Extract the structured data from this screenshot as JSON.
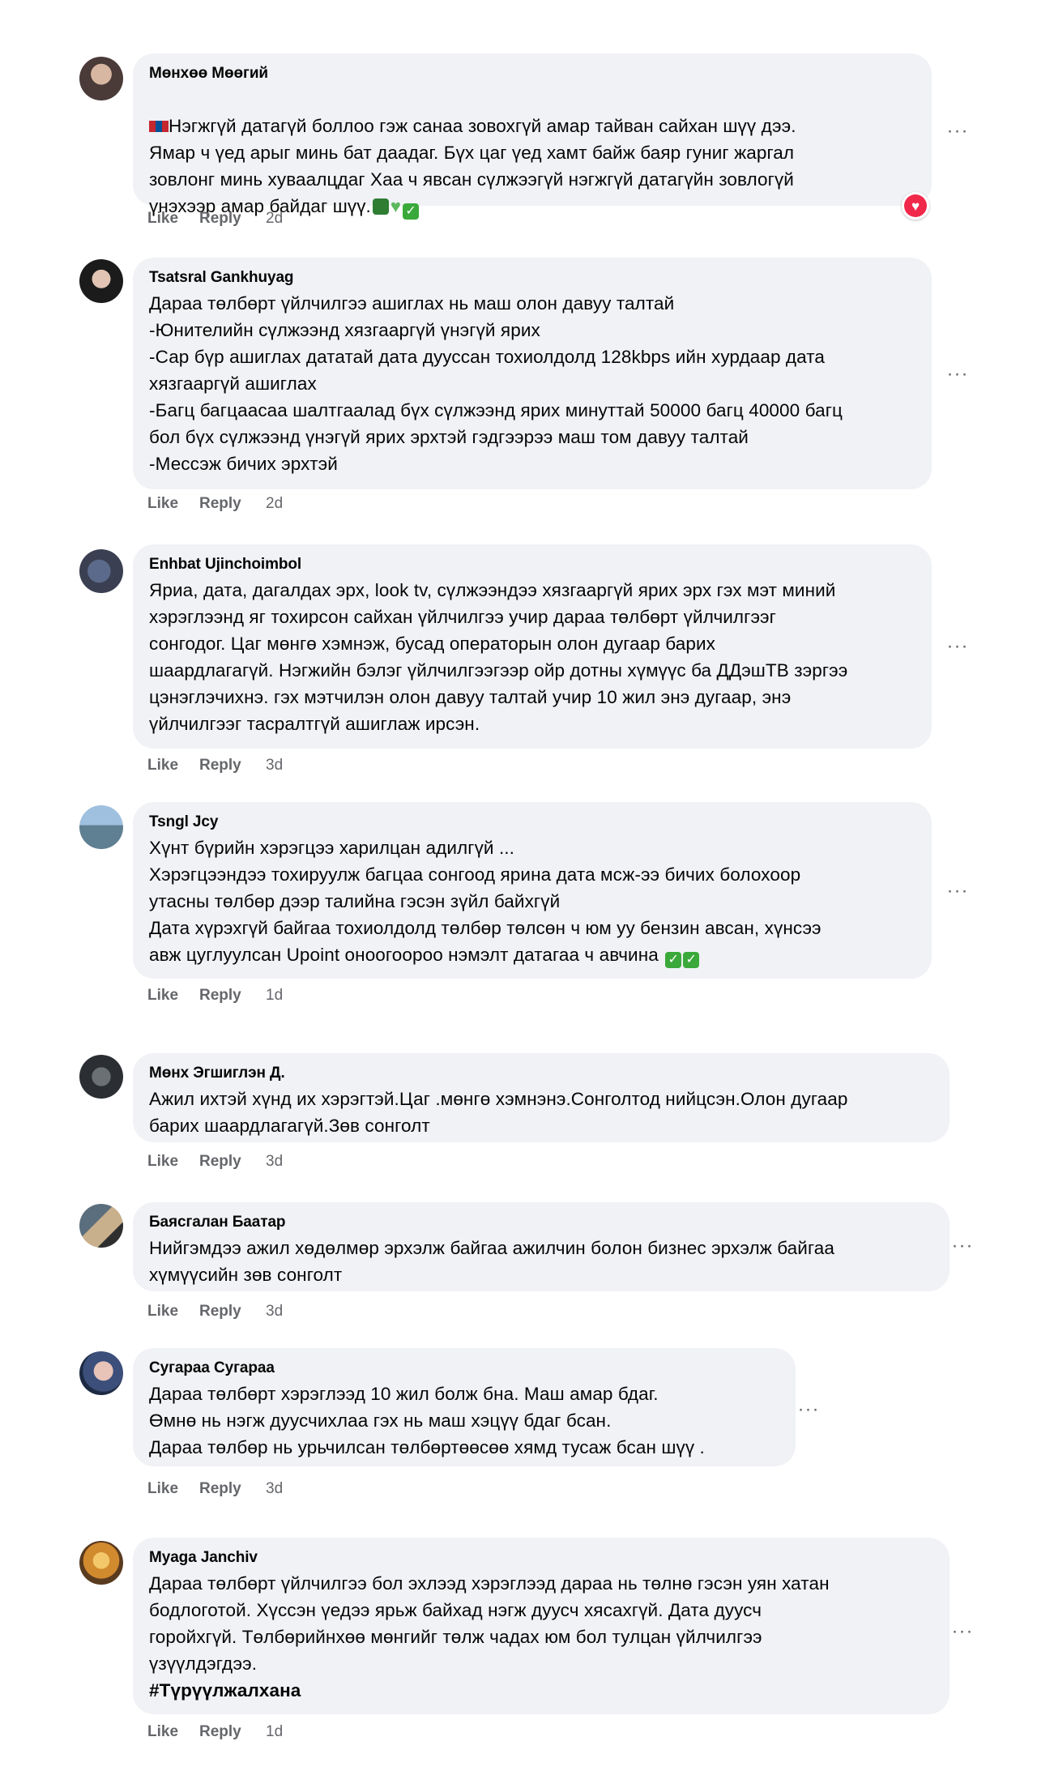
{
  "actions": {
    "like": "Like",
    "reply": "Reply"
  },
  "comments": [
    {
      "author": "Мөнхөө Мөөгий",
      "text": "Нэгжгүй датагүй боллоо гэж санаа зовохгүй амар тайван сайхан шүү дээ.\nЯмар ч үед арыг минь бат даадаг. Бүх цаг үед хамт байж баяр гуниг жаргал\nзовлонг минь хуваалцдаг Хаа ч явсан сүлжээгүй нэгжгүй датагүйн зовлогүй\nүнэхээр амар байдаг шүү.",
      "time": "2d",
      "reaction": "heart"
    },
    {
      "author": "Tsatsral Gankhuyag",
      "text": "Дараа төлбөрт үйлчилгээ ашиглах нь маш олон давуу талтай\n-Юнителийн сүлжээнд хязгааргүй үнэгүй ярих\n-Сар бүр ашиглах дататай дата дууссан тохиолдолд 128kbps ийн хурдаар дата\nхязгааргүй ашиглах\n-Багц багцаасаа шалтгаалад бүх сүлжээнд ярих минуттай 50000 багц 40000 багц\nбол бүх сүлжээнд үнэгүй ярих эрхтэй гэдгээрээ маш том давуу талтай\n-Мессэж бичих эрхтэй",
      "time": "2d"
    },
    {
      "author": "Enhbat Ujinchoimbol",
      "text": "Яриа, дата, дагалдах эрх, look tv, сүлжээндээ хязгааргүй ярих эрх гэх мэт миний\nхэрэглээнд яг тохирсон сайхан үйлчилгээ учир дараа төлбөрт үйлчилгээг\nсонгодог. Цаг мөнгө хэмнэж, бусад операторын олон дугаар барих\nшаардлагагүй. Нэгжийн бэлэг үйлчилгээгээр ойр дотны хүмүүс ба ДДэшТВ зэргээ\nцэнэглэчихнэ. гэх мэтчилэн олон давуу талтай учир 10 жил энэ дугаар, энэ\nүйлчилгээг тасралтгүй ашиглаж ирсэн.",
      "time": "3d"
    },
    {
      "author": "Tsngl Jcy",
      "text": "Хүнт бүрийн хэрэгцээ харилцан адилгүй ...\nХэрэгцээндээ тохируулж багцаа сонгоод ярина дата мсж-ээ бичих болохоор\nутасны төлбөр дээр талийна гэсэн зүйл байхгүй\nДата хүрэхгүй байгаа тохиолдолд төлбөр төлсөн ч юм уу бензин авсан, хүнсээ\nавж цуглуулсан Upoint оноогоороо нэмэлт датагаа ч авчина",
      "time": "1d"
    },
    {
      "author": "Мөнх Эгшиглэн Д.",
      "text": "Ажил ихтэй хүнд их хэрэгтэй.Цаг .мөнгө хэмнэнэ.Сонголтод нийцсэн.Олон дугаар\nбарих шаардлагагүй.Зөв сонголт",
      "time": "3d"
    },
    {
      "author": "Баясгалан Баатар",
      "text": "Нийгэмдээ ажил хөдөлмөр эрхэлж байгаа ажилчин болон бизнес эрхэлж байгаа\nхүмүүсийн зөв сонголт",
      "time": "3d"
    },
    {
      "author": "Сугараа Сугараа",
      "text": "Дараа төлбөрт хэрэглээд 10 жил болж бна. Маш амар бдаг.\nӨмнө нь нэгж дуусчихлаа гэх нь маш хэцүү бдаг бсан.\nДараа төлбөр нь урьчилсан төлбөртөөсөө хямд тусаж бсан шүү .",
      "time": "3d"
    },
    {
      "author": "Myaga Janchiv",
      "text": "Дараа төлбөрт үйлчилгээ бол эхлээд хэрэглээд дараа нь төлнө гэсэн уян хатан\nбодлоготой. Хүссэн үедээ ярьж байхад нэгж дуусч хясахгүй. Дата дуусч\nгоройхгүй. Төлбөрийнхөө мөнгийг төлж чадах юм бол тулцан үйлчилгээ\nүзүүлдэгдээ.",
      "hashtag": "#Түрүүлжалхана",
      "time": "1d"
    }
  ],
  "icons": {
    "more": "more-options-icon",
    "heart": "heart-reaction-icon",
    "flag": "mongolia-flag-icon",
    "green_heart": "green-heart-icon",
    "green_book": "green-book-icon",
    "check": "check-mark-icon"
  }
}
